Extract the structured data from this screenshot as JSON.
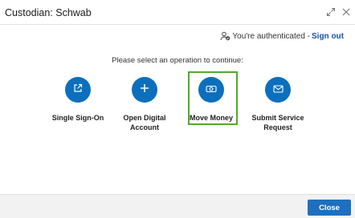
{
  "dialog": {
    "title": "Custodian: Schwab"
  },
  "auth": {
    "status_text": "You're authenticated - ",
    "signout_label": "Sign out"
  },
  "prompt": "Please select an operation to continue:",
  "operations": [
    {
      "label": "Single Sign-On",
      "icon": "external-link-icon"
    },
    {
      "label": "Open Digital Account",
      "icon": "plus-icon"
    },
    {
      "label": "Move Money",
      "icon": "money-icon",
      "selected": true
    },
    {
      "label": "Submit Service Request",
      "icon": "envelope-icon"
    }
  ],
  "footer": {
    "close_label": "Close"
  },
  "colors": {
    "accent_blue": "#0c6fbd",
    "selection_green": "#52a831",
    "link_blue": "#1452b8",
    "button_blue": "#1f6fbf"
  }
}
